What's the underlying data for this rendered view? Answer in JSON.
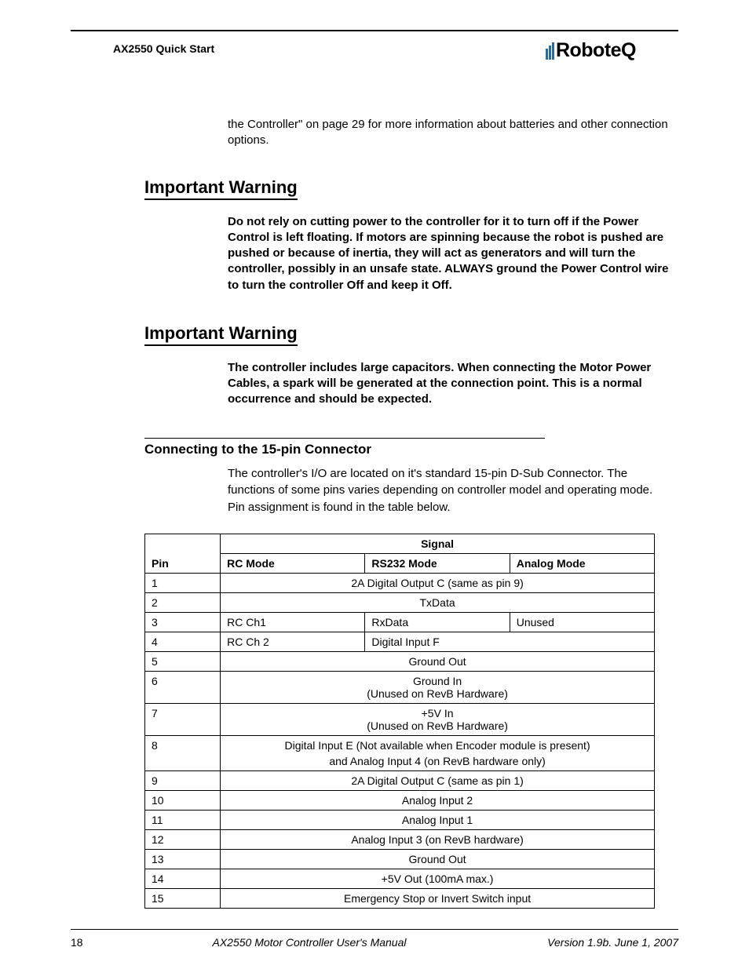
{
  "header": {
    "title": "AX2550 Quick Start",
    "logo_text": "RoboteQ"
  },
  "intro": "the Controller\" on page 29 for more information about batteries and other connection options.",
  "warning1": {
    "heading": "Important Warning",
    "body": "Do not rely on cutting power to the controller for it to turn off if the Power Control is left floating. If motors are spinning because the robot is pushed are pushed or because of inertia, they will act as generators and will turn the controller, possibly in an unsafe state. ALWAYS ground the Power Control wire to turn the controller Off and keep it Off."
  },
  "warning2": {
    "heading": "Important Warning",
    "body": "The controller includes large capacitors. When connecting the Motor Power Cables, a spark will be generated at the connection point. This is a normal occurrence and should be expected."
  },
  "section": {
    "heading": "Connecting to the 15-pin Connector",
    "body": "The controller's I/O are located on it's standard 15-pin D-Sub Connector. The functions of some pins varies depending on controller model and operating mode. Pin assignment is found in the table below."
  },
  "table": {
    "headers": {
      "pin": "Pin",
      "signal": "Signal",
      "rc": "RC Mode",
      "rs232": "RS232 Mode",
      "analog": "Analog Mode"
    },
    "rows": [
      {
        "pin": "1",
        "span": "2A Digital Output C (same as pin 9)"
      },
      {
        "pin": "2",
        "span": "TxData"
      },
      {
        "pin": "3",
        "rc": "RC Ch1",
        "rs232": "RxData",
        "analog": "Unused"
      },
      {
        "pin": "4",
        "rc": "RC Ch 2",
        "rs232": "Digital Input F"
      },
      {
        "pin": "5",
        "span": "Ground Out"
      },
      {
        "pin": "6",
        "span_l1": "Ground In",
        "span_l2": "(Unused on RevB Hardware)"
      },
      {
        "pin": "7",
        "span_l1": "+5V In",
        "span_l2": "(Unused on RevB Hardware)"
      },
      {
        "pin": "8",
        "span_l1": "Digital Input E (Not available when Encoder module is present)",
        "span_l2": "and Analog Input 4 (on RevB hardware only)"
      },
      {
        "pin": "9",
        "span": "2A Digital Output C (same as pin 1)"
      },
      {
        "pin": "10",
        "span": "Analog Input 2"
      },
      {
        "pin": "11",
        "span": "Analog Input 1"
      },
      {
        "pin": "12",
        "span": "Analog Input 3 (on RevB hardware)"
      },
      {
        "pin": "13",
        "span": "Ground Out"
      },
      {
        "pin": "14",
        "span": "+5V Out (100mA max.)"
      },
      {
        "pin": "15",
        "span": "Emergency Stop or Invert Switch input"
      }
    ]
  },
  "footer": {
    "page": "18",
    "title": "AX2550 Motor Controller User's Manual",
    "version": "Version 1.9b. June 1, 2007"
  }
}
